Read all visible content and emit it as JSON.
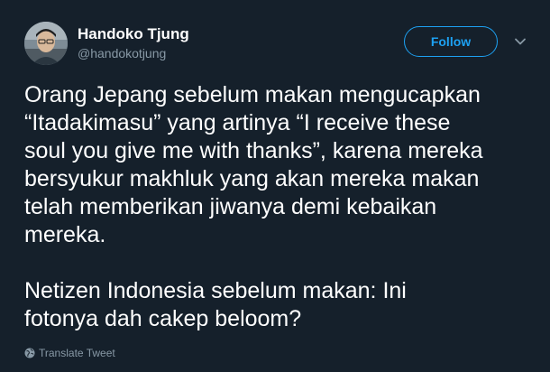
{
  "colors": {
    "background": "#15202b",
    "text_primary": "#ffffff",
    "text_secondary": "#8899a6",
    "accent": "#1da1f2"
  },
  "author": {
    "display_name": "Handoko Tjung",
    "username": "@handokotjung",
    "avatar_icon": "profile-photo"
  },
  "follow_button": {
    "label": "Follow"
  },
  "menu": {
    "icon": "chevron-down-icon"
  },
  "tweet": {
    "text": "Orang Jepang sebelum makan mengucapkan\n“Itadakimasu” yang artinya “I receive these\nsoul you give me with thanks”, karena mereka\nbersyukur makhluk yang akan mereka makan\ntelah memberikan jiwanya demi kebaikan\nmereka.\n\nNetizen Indonesia sebelum makan: Ini\nfotonya dah cakep beloom?"
  },
  "translate": {
    "label": "Translate Tweet",
    "icon": "globe-icon"
  }
}
